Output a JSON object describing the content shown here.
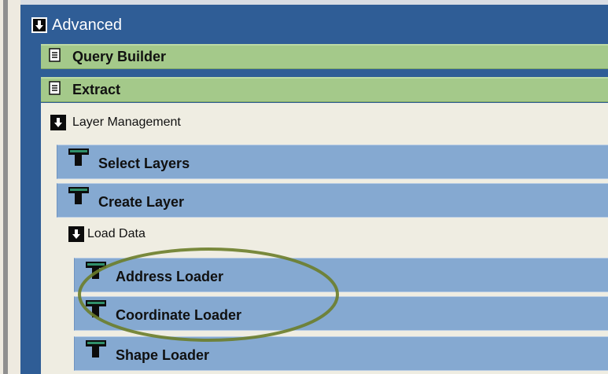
{
  "advanced": {
    "label": "Advanced"
  },
  "menu": {
    "query_builder": "Query Builder",
    "extract": "Extract",
    "layer_management": {
      "label": "Layer Management",
      "items": {
        "select_layers": "Select Layers",
        "create_layer": "Create Layer"
      },
      "load_data": {
        "label": "Load Data",
        "items": {
          "address_loader": "Address Loader",
          "coordinate_loader": "Coordinate Loader",
          "shape_loader": "Shape Loader"
        }
      }
    }
  },
  "colors": {
    "frame_blue": "#2f5d96",
    "green_row": "#a4c98a",
    "blue_row": "#85a9d1",
    "section_bg": "#efede2",
    "highlight_ellipse": "#6b7d2a"
  },
  "icons": {
    "expand": "expand-arrow-icon",
    "document": "document-icon",
    "tool": "hammer-icon"
  }
}
